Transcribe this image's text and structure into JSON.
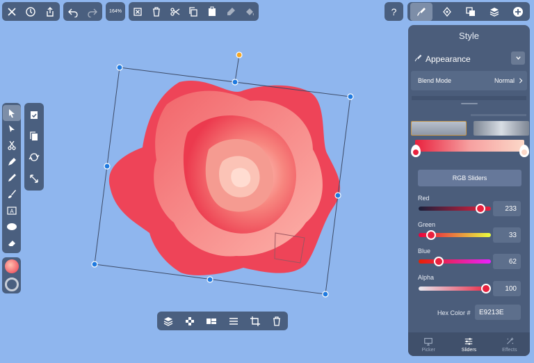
{
  "toolbar": {
    "zoom": "164%"
  },
  "panel": {
    "title": "Style",
    "appearance_label": "Appearance",
    "blend_mode_label": "Blend Mode",
    "blend_mode_value": "Normal",
    "rgb_button_label": "RGB Sliders",
    "red_label": "Red",
    "red_value": "233",
    "green_label": "Green",
    "green_value": "33",
    "blue_label": "Blue",
    "blue_value": "62",
    "alpha_label": "Alpha",
    "alpha_value": "100",
    "hex_label": "Hex Color #",
    "hex_value": "E9213E",
    "tabs": [
      {
        "label": "Picker"
      },
      {
        "label": "Sliders"
      },
      {
        "label": "Effects"
      }
    ]
  },
  "colors": {
    "fill": "#e9213e",
    "canvas": "#8fb6ee",
    "toolbar": "#4a5f7f"
  },
  "icons": [
    "close-icon",
    "history-icon",
    "share-icon",
    "undo-icon",
    "redo-icon",
    "clear-icon",
    "trash-icon",
    "scissors-icon",
    "copy-icon",
    "paste-icon",
    "paint-icon",
    "fill-bucket-icon",
    "help-icon",
    "brush-icon",
    "pen-nib-icon",
    "arrange-icon",
    "layers-icon",
    "add-icon"
  ]
}
